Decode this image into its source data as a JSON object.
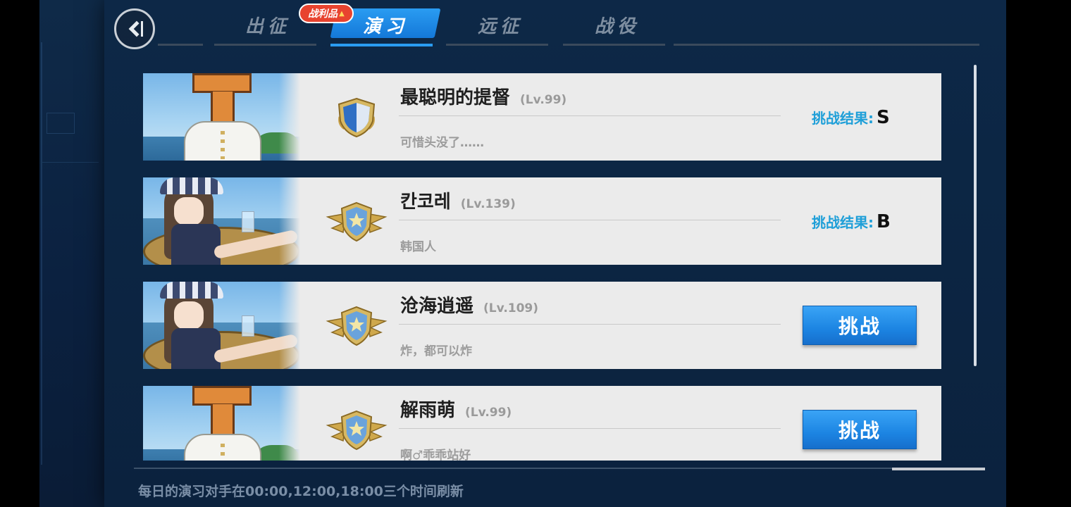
{
  "tabs": [
    {
      "label": "出征",
      "active": false
    },
    {
      "label": "演习",
      "active": true
    },
    {
      "label": "远征",
      "active": false
    },
    {
      "label": "战役",
      "active": false
    }
  ],
  "badge": {
    "label": "战利品"
  },
  "result_label": "挑战结果:",
  "opponents": [
    {
      "name": "最聪明的提督",
      "level": "(Lv.99)",
      "motto": "可惜头没了……",
      "avatar": "t-head-admiral",
      "medal": "plain-shield-medal",
      "result": "S",
      "action": null
    },
    {
      "name": "칸코레",
      "level": "(Lv.139)",
      "motto": "韩国人",
      "avatar": "anime-girl-float",
      "medal": "winged-star-medal",
      "result": "B",
      "action": null
    },
    {
      "name": "沧海逍遥",
      "level": "(Lv.109)",
      "motto": "炸，都可以炸",
      "avatar": "anime-girl-float",
      "medal": "winged-star-medal",
      "result": null,
      "action": "挑战"
    },
    {
      "name": "解雨萌",
      "level": "(Lv.99)",
      "motto": "啊♂乖乖站好",
      "avatar": "t-head-admiral",
      "medal": "winged-star-medal",
      "result": null,
      "action": "挑战"
    }
  ],
  "footer": "每日的演习对手在00:00,12:00,18:00三个时间刷新",
  "colors": {
    "accent": "#1f9fd8",
    "button": "#1c84e2",
    "badge": "#e8432f",
    "card": "#ebebeb"
  }
}
